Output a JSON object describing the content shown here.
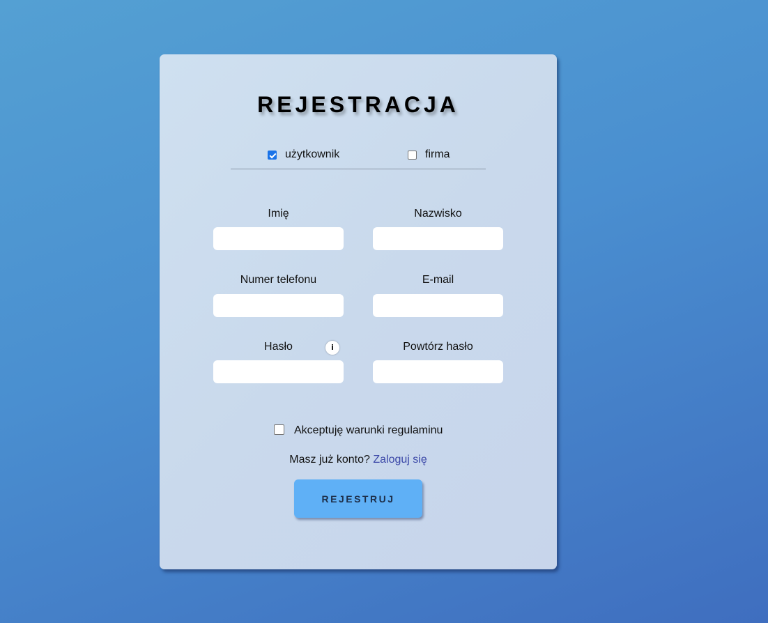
{
  "form": {
    "title": "REJESTRACJA",
    "account_types": [
      {
        "label": "użytkownik",
        "checked": true
      },
      {
        "label": "firma",
        "checked": false
      }
    ],
    "fields": {
      "first_name": {
        "label": "Imię",
        "value": ""
      },
      "last_name": {
        "label": "Nazwisko",
        "value": ""
      },
      "phone": {
        "label": "Numer telefonu",
        "value": ""
      },
      "email": {
        "label": "E-mail",
        "value": ""
      },
      "password": {
        "label": "Hasło",
        "value": ""
      },
      "password_repeat": {
        "label": "Powtórz hasło",
        "value": ""
      }
    },
    "password_info_icon": "i",
    "terms": {
      "label": "Akceptuję warunki regulaminu",
      "checked": false
    },
    "login_prompt": "Masz już konto?",
    "login_link": "Zaloguj się",
    "submit_label": "REJESTRUJ"
  },
  "colors": {
    "checkbox_accent": "#1a73e8",
    "link": "#3b48a8",
    "submit_button": "#5fb0f6"
  },
  "icons": {
    "password_info": "info-icon"
  }
}
